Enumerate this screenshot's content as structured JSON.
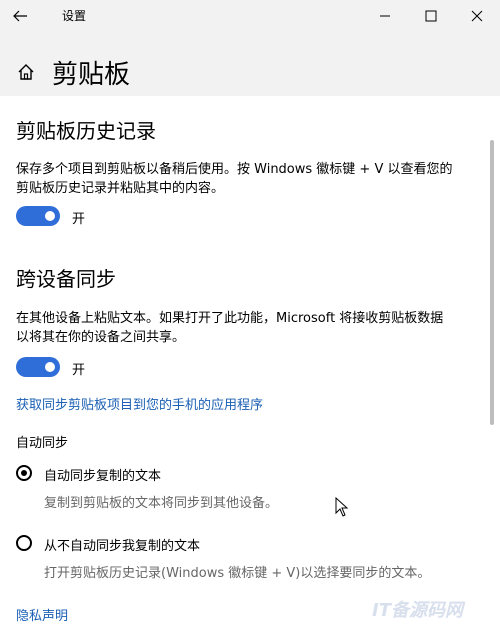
{
  "window": {
    "title": "设置",
    "controls": {
      "minimize": "minimize-icon",
      "maximize": "maximize-icon",
      "close": "close-icon"
    }
  },
  "header": {
    "title": "剪贴板"
  },
  "clipboard_history": {
    "heading": "剪贴板历史记录",
    "description": "保存多个项目到剪贴板以备稍后使用。按 Windows 徽标键 + V 以查看您的剪贴板历史记录并粘贴其中的内容。",
    "toggle_label": "开",
    "toggle_on": true
  },
  "sync": {
    "heading": "跨设备同步",
    "description": "在其他设备上粘贴文本。如果打开了此功能，Microsoft 将接收剪贴板数据以将其在你的设备之间共享。",
    "toggle_label": "开",
    "toggle_on": true,
    "link": "获取同步剪贴板项目到您的手机的应用程序",
    "auto_sync_label": "自动同步",
    "options": [
      {
        "label": "自动同步复制的文本",
        "desc": "复制到剪贴板的文本将同步到其他设备。",
        "selected": true
      },
      {
        "label": "从不自动同步我复制的文本",
        "desc": "打开剪贴板历史记录(Windows 徽标键 + V)以选择要同步的文本。",
        "selected": false
      }
    ]
  },
  "privacy_link": "隐私声明",
  "watermark": "IT备源码网",
  "accent_color": "#2f6ed8",
  "link_color": "#1a5fb4"
}
